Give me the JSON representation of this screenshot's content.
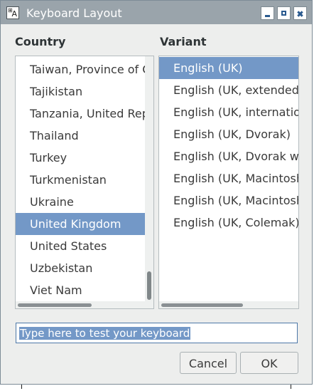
{
  "window": {
    "title": "Keyboard Layout",
    "icon": "keyboard-app-icon",
    "icon_letters": [
      "⊞",
      "A"
    ],
    "controls": [
      "minimize",
      "maximize",
      "close"
    ]
  },
  "country": {
    "label": "Country",
    "items": [
      "Taiwan, Province of China",
      "Tajikistan",
      "Tanzania, United Republic of",
      "Thailand",
      "Turkey",
      "Turkmenistan",
      "Ukraine",
      "United Kingdom",
      "United States",
      "Uzbekistan",
      "Viet Nam"
    ],
    "selected": "United Kingdom"
  },
  "variant": {
    "label": "Variant",
    "items": [
      "English (UK)",
      "English (UK, extended WinKeys)",
      "English (UK, international with dead keys)",
      "English (UK, Dvorak)",
      "English (UK, Dvorak with UK punctuation)",
      "English (UK, Macintosh)",
      "English (UK, Macintosh international)",
      "English (UK, Colemak)"
    ],
    "selected": "English (UK)"
  },
  "test_field": {
    "value": "Type here to test your keyboard"
  },
  "buttons": {
    "cancel": "Cancel",
    "ok": "OK"
  },
  "colors": {
    "titlebar": "#9aa4ab",
    "selection": "#7398c7",
    "window_bg": "#edeeed"
  }
}
